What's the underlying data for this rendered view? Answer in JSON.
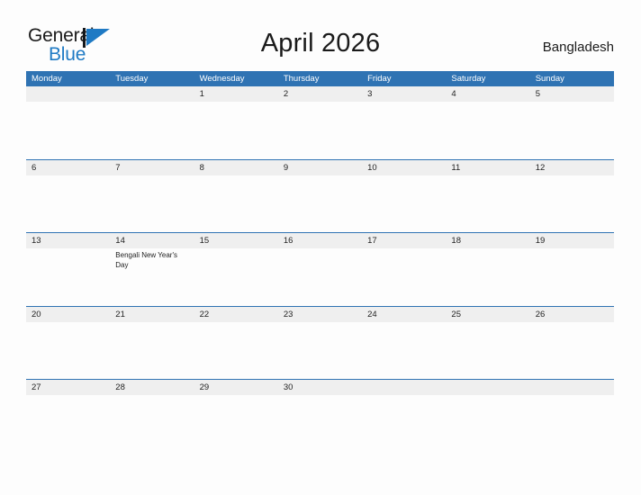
{
  "brand": {
    "word_one": "General",
    "word_two": "Blue",
    "accent_color": "#1f7ac4",
    "mark_icon": "triangle-flag-icon"
  },
  "header": {
    "title": "April 2026",
    "country": "Bangladesh"
  },
  "theme": {
    "header_blue": "#2f73b3",
    "band_gray": "#efefef",
    "page_background": "#fdfdfd",
    "text": "#1f1f1f"
  },
  "calendar": {
    "weekday_headers": [
      "Monday",
      "Tuesday",
      "Wednesday",
      "Thursday",
      "Friday",
      "Saturday",
      "Sunday"
    ],
    "weeks": [
      [
        {
          "day": "",
          "event": ""
        },
        {
          "day": "",
          "event": ""
        },
        {
          "day": "1",
          "event": ""
        },
        {
          "day": "2",
          "event": ""
        },
        {
          "day": "3",
          "event": ""
        },
        {
          "day": "4",
          "event": ""
        },
        {
          "day": "5",
          "event": ""
        }
      ],
      [
        {
          "day": "6",
          "event": ""
        },
        {
          "day": "7",
          "event": ""
        },
        {
          "day": "8",
          "event": ""
        },
        {
          "day": "9",
          "event": ""
        },
        {
          "day": "10",
          "event": ""
        },
        {
          "day": "11",
          "event": ""
        },
        {
          "day": "12",
          "event": ""
        }
      ],
      [
        {
          "day": "13",
          "event": ""
        },
        {
          "day": "14",
          "event": "Bengali New Year's Day"
        },
        {
          "day": "15",
          "event": ""
        },
        {
          "day": "16",
          "event": ""
        },
        {
          "day": "17",
          "event": ""
        },
        {
          "day": "18",
          "event": ""
        },
        {
          "day": "19",
          "event": ""
        }
      ],
      [
        {
          "day": "20",
          "event": ""
        },
        {
          "day": "21",
          "event": ""
        },
        {
          "day": "22",
          "event": ""
        },
        {
          "day": "23",
          "event": ""
        },
        {
          "day": "24",
          "event": ""
        },
        {
          "day": "25",
          "event": ""
        },
        {
          "day": "26",
          "event": ""
        }
      ],
      [
        {
          "day": "27",
          "event": ""
        },
        {
          "day": "28",
          "event": ""
        },
        {
          "day": "29",
          "event": ""
        },
        {
          "day": "30",
          "event": ""
        },
        {
          "day": "",
          "event": ""
        },
        {
          "day": "",
          "event": ""
        },
        {
          "day": "",
          "event": ""
        }
      ]
    ]
  }
}
